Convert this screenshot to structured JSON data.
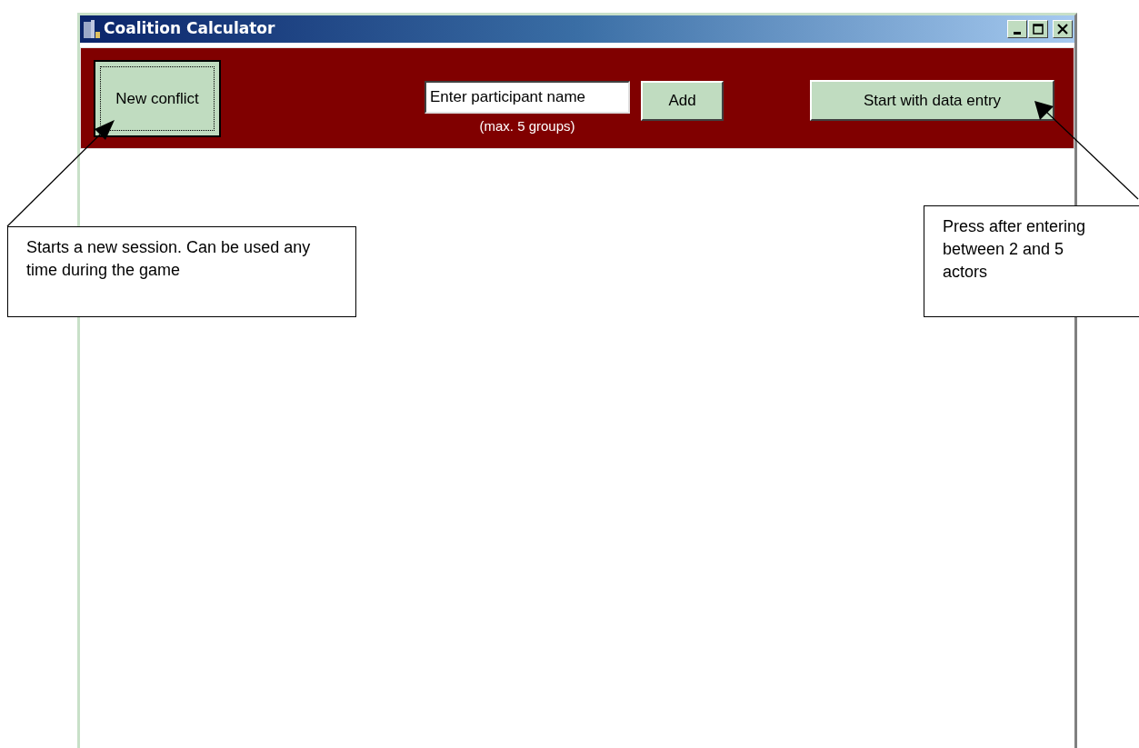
{
  "window": {
    "title": "Coalition Calculator"
  },
  "toolbar": {
    "new_conflict_button": "New conflict",
    "name_field": {
      "value": "Enter participant name"
    },
    "hint": "(max. 5 groups)",
    "add_button": "Add",
    "start_button": "Start with data entry"
  },
  "callouts": [
    {
      "kind": "left",
      "text": "Starts a new session. Can be used any time during the game"
    },
    {
      "kind": "right",
      "text": "Press after entering between 2 and 5 actors"
    }
  ]
}
